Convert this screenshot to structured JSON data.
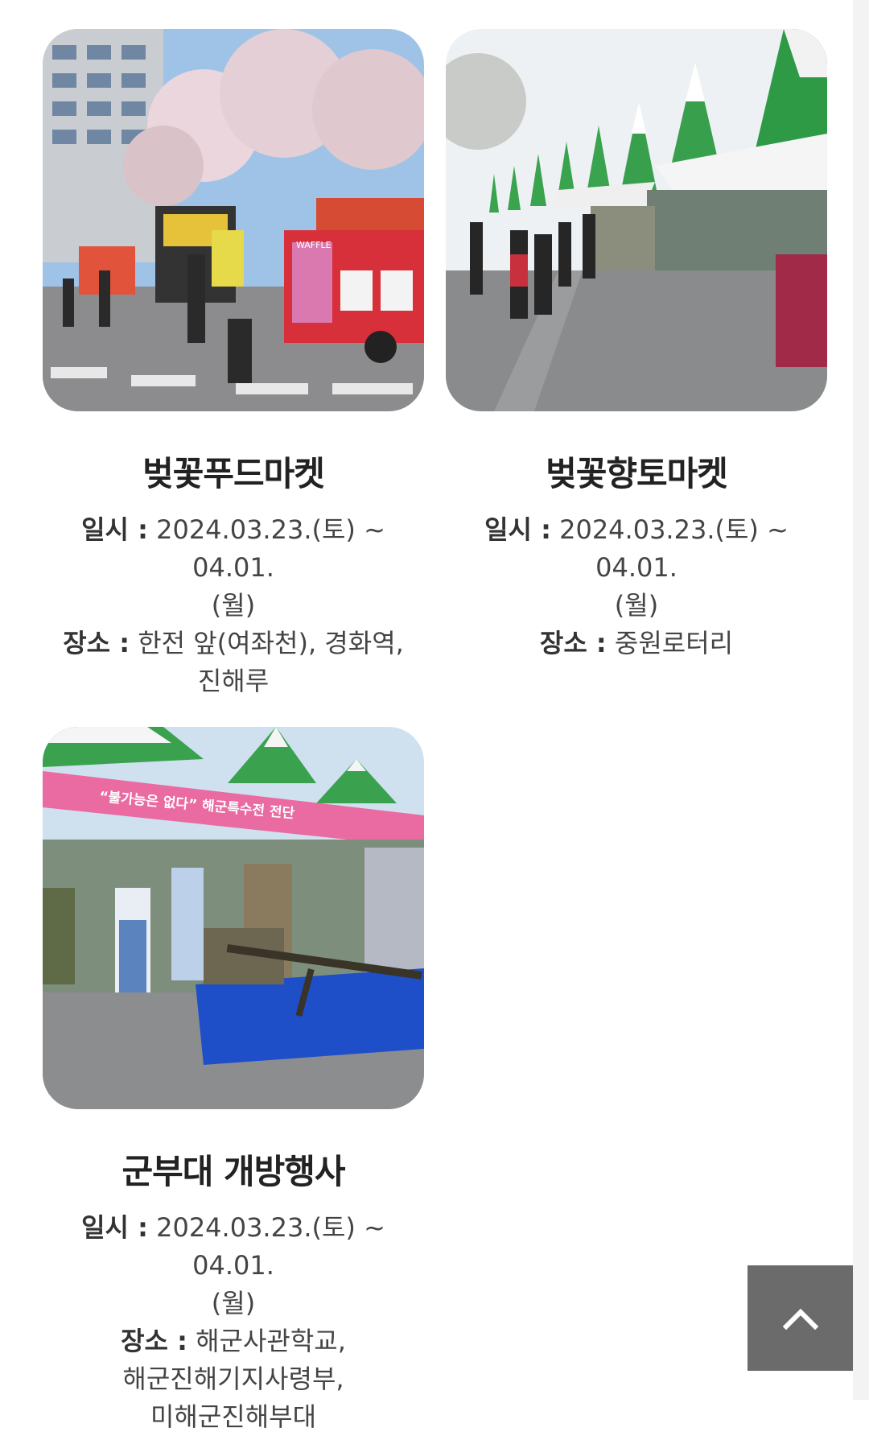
{
  "cards": [
    {
      "title": "벚꽃푸드마켓",
      "date_label": "일시 :",
      "date_line1": "2024.03.23.(토) ~ 04.01.",
      "date_line2": "(월)",
      "place_label": "장소 :",
      "place_line1": "한전 앞(여좌천), 경화역,",
      "place_line2": "진해루",
      "photo_icon": "food-truck-street-photo"
    },
    {
      "title": "벚꽃향토마켓",
      "date_label": "일시 :",
      "date_line1": "2024.03.23.(토) ~ 04.01.",
      "date_line2": "(월)",
      "place_label": "장소 :",
      "place_line1": "중원로터리",
      "photo_icon": "market-tents-photo"
    },
    {
      "title": "군부대 개방행사",
      "date_label": "일시 :",
      "date_line1": "2024.03.23.(토) ~ 04.01.",
      "date_line2": "(월)",
      "place_label": "장소 :",
      "place_line1": "해군사관학교,",
      "place_line2": "해군진해기지사령부,",
      "place_line3": "미해군진해부대",
      "photo_icon": "military-open-event-photo"
    }
  ],
  "photo_text": {
    "truck_sign": "WAFFLE",
    "banner": "“불가능은 없다” 해군특수전 전단"
  },
  "top_button": {
    "icon": "chevron-up-icon"
  },
  "colors": {
    "top_button_bg": "#6b6b6b",
    "title": "#222222",
    "body_text": "#444444"
  }
}
